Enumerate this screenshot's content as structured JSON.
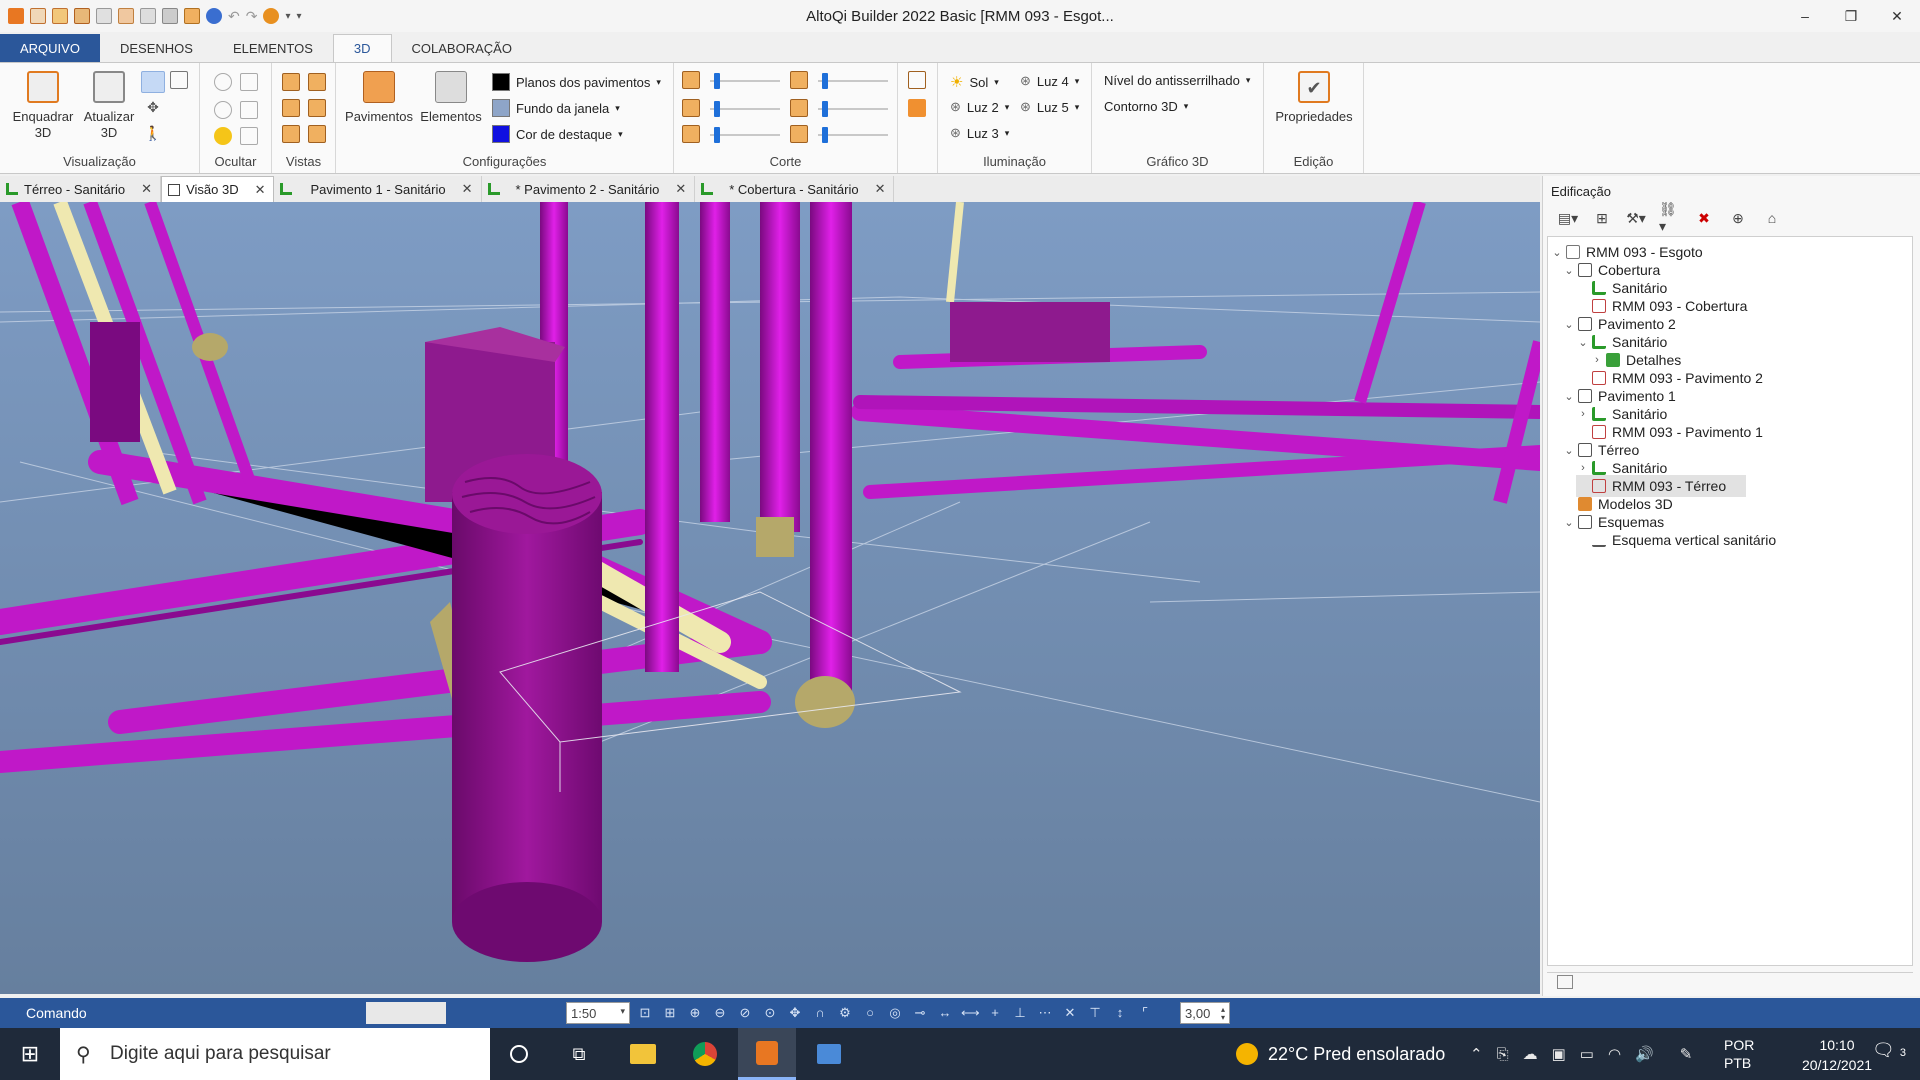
{
  "window": {
    "title": "AltoQi Builder 2022 Basic [RMM 093 - Esgot...",
    "controls": {
      "minimize": "–",
      "restore": "❐",
      "close": "✕"
    }
  },
  "ribbon_tabs": [
    {
      "label": "ARQUIVO"
    },
    {
      "label": "DESENHOS"
    },
    {
      "label": "ELEMENTOS"
    },
    {
      "label": "3D"
    },
    {
      "label": "COLABORAÇÃO"
    }
  ],
  "ribbon": {
    "visualizacao": {
      "label": "Visualização",
      "enquadrar": "Enquadrar\n3D",
      "atualizar": "Atualizar\n3D"
    },
    "ocultar": {
      "label": "Ocultar"
    },
    "vistas": {
      "label": "Vistas"
    },
    "configuracoes": {
      "label": "Configurações",
      "pavimentos": "Pavimentos",
      "elementos": "Elementos",
      "planos": "Planos dos pavimentos",
      "fundo": "Fundo da janela",
      "cor": "Cor de destaque"
    },
    "corte": {
      "label": "Corte"
    },
    "iluminacao": {
      "label": "Iluminação",
      "sol": "Sol",
      "luz2": "Luz 2",
      "luz3": "Luz 3",
      "luz4": "Luz 4",
      "luz5": "Luz 5"
    },
    "grafico": {
      "label": "Gráfico 3D",
      "antisserrilhado": "Nível do antisserrilhado",
      "contorno": "Contorno 3D"
    },
    "edicao": {
      "label": "Edição",
      "propriedades": "Propriedades"
    }
  },
  "doc_tabs": [
    {
      "label": "Térreo - Sanitário"
    },
    {
      "label": "Visão 3D"
    },
    {
      "label": "Pavimento 1 - Sanitário"
    },
    {
      "label": "* Pavimento 2 - Sanitário"
    },
    {
      "label": "* Cobertura - Sanitário"
    }
  ],
  "panel": {
    "title": "Edificação",
    "tree": [
      {
        "label": "RMM 093 - Esgoto",
        "chev": "⌄"
      },
      {
        "label": "Cobertura",
        "chev": "⌄"
      },
      {
        "label": "Sanitário",
        "chev": ""
      },
      {
        "label": "RMM 093 - Cobertura",
        "chev": ""
      },
      {
        "label": "Pavimento 2",
        "chev": "⌄"
      },
      {
        "label": "Sanitário",
        "chev": "⌄"
      },
      {
        "label": "Detalhes",
        "chev": "›"
      },
      {
        "label": "RMM 093 - Pavimento 2",
        "chev": ""
      },
      {
        "label": "Pavimento 1",
        "chev": "⌄"
      },
      {
        "label": "Sanitário",
        "chev": "›"
      },
      {
        "label": "RMM 093 - Pavimento 1",
        "chev": ""
      },
      {
        "label": "Térreo",
        "chev": "⌄"
      },
      {
        "label": "Sanitário",
        "chev": "›"
      },
      {
        "label": "RMM 093 - Térreo",
        "chev": ""
      },
      {
        "label": "Modelos 3D",
        "chev": ""
      },
      {
        "label": "Esquemas",
        "chev": "⌄"
      },
      {
        "label": "Esquema vertical sanitário",
        "chev": ""
      }
    ]
  },
  "statusbar": {
    "command_label": "Comando",
    "scale": "1:50",
    "spin_value": "3,00"
  },
  "taskbar": {
    "search_placeholder": "Digite aqui para pesquisar",
    "weather": "22°C  Pred ensolarado",
    "lang_line1": "POR",
    "lang_line2": "PTB",
    "time": "10:10",
    "date": "20/12/2021",
    "notifications": "3"
  },
  "colors": {
    "accent": "#2b579a",
    "pipe": "#c000c8",
    "pipe_dark": "#8a0a8a",
    "fitting": "#b5a86a",
    "viewport_bg": "#6d87a8"
  }
}
